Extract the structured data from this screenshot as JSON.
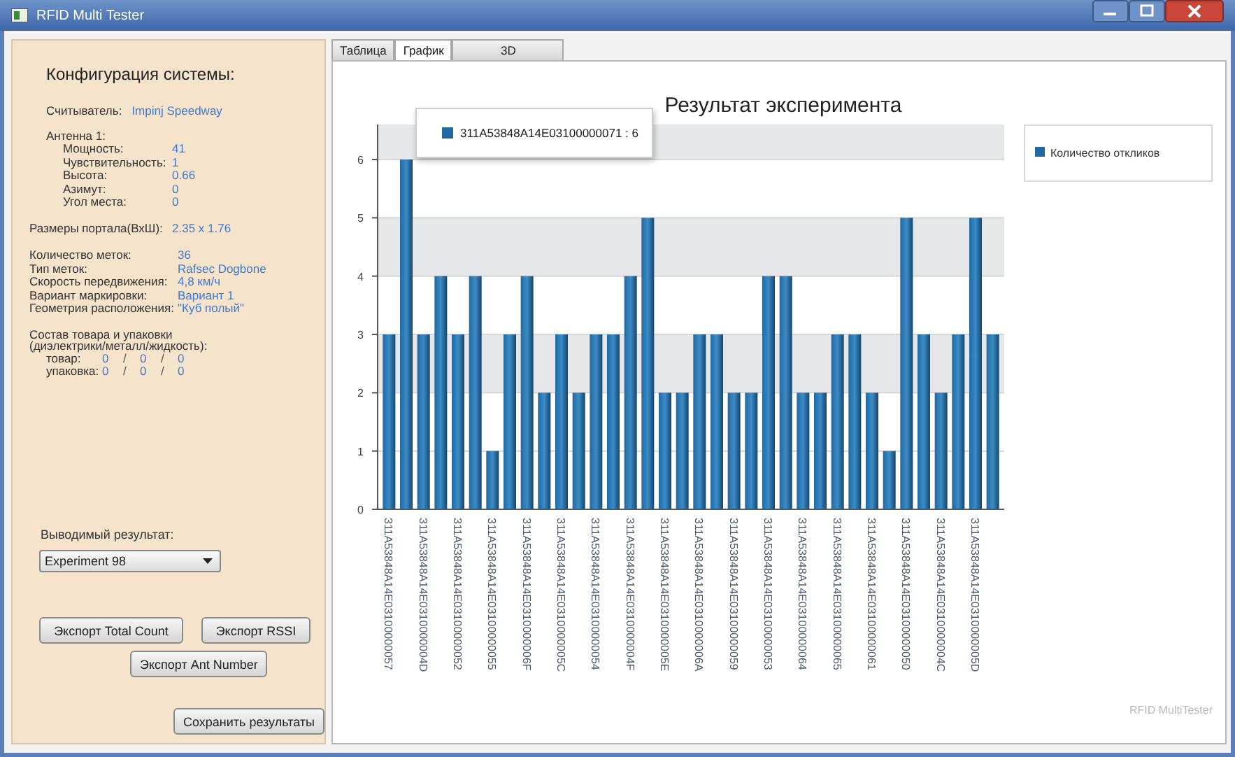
{
  "window": {
    "title": "RFID Multi Tester"
  },
  "config": {
    "title": "Конфигурация системы:",
    "reader": {
      "label": "Считыватель:",
      "value": "Impinj Speedway"
    },
    "antenna": {
      "title": "Антенна 1:",
      "rows": [
        {
          "label": "Мощность:",
          "value": "41"
        },
        {
          "label": "Чувствительность:",
          "value": "1"
        },
        {
          "label": "Высота:",
          "value": "0.66"
        },
        {
          "label": "Азимут:",
          "value": "0"
        },
        {
          "label": "Угол места:",
          "value": "0"
        }
      ]
    },
    "portal": {
      "label": "Размеры портала(ВхШ):",
      "value": "2.35 x 1.76"
    },
    "tags": [
      {
        "label": "Количество меток:",
        "value": "36"
      },
      {
        "label": "Тип меток:",
        "value": "Rafsec Dogbone"
      },
      {
        "label": "Скорость передвижения:",
        "value": "4,8 км/ч"
      },
      {
        "label": "Вариант маркировки:",
        "value": "Вариант 1"
      },
      {
        "label": "Геометрия расположения:",
        "value": "\"Куб полый\""
      }
    ],
    "composition": {
      "title": [
        "Состав товара и упаковки",
        "(диэлектрики/металл/жидкость):"
      ],
      "rows": [
        {
          "label": "товар:",
          "cells": [
            {
              "kind": "value",
              "text": "0"
            },
            {
              "kind": "sep",
              "text": "/"
            },
            {
              "kind": "value",
              "text": "0"
            },
            {
              "kind": "sep",
              "text": "/"
            },
            {
              "kind": "value",
              "text": "0"
            }
          ]
        },
        {
          "label": "упаковка:",
          "cells": [
            {
              "kind": "value",
              "text": "0"
            },
            {
              "kind": "sep",
              "text": "/"
            },
            {
              "kind": "value",
              "text": "0"
            },
            {
              "kind": "sep",
              "text": "/"
            },
            {
              "kind": "value",
              "text": "0"
            }
          ]
        }
      ]
    }
  },
  "result": {
    "label": "Выводимый результат:",
    "value": "Experiment 98"
  },
  "buttons": {
    "row1": [
      "Экспорт Total Count",
      "Экспорт RSSI"
    ],
    "row2": [
      "Экспорт Ant Number"
    ],
    "save": "Сохранить результаты"
  },
  "tabs": [
    {
      "label": "Таблица",
      "selected": false
    },
    {
      "label": "График",
      "selected": true
    },
    {
      "label": "3D",
      "selected": false
    }
  ],
  "chart": {
    "tooltip": "311A53848A14E03100000071 : 6",
    "watermark": "RFID MultiTester",
    "chart_data": {
      "type": "bar",
      "title": "Результат эксперимента",
      "categories": [
        "311A53848A14E03100000057",
        null,
        "311A53848A14E0310000004D",
        null,
        "311A53848A14E03100000052",
        null,
        "311A53848A14E03100000055",
        null,
        "311A53848A14E0310000006F",
        null,
        "311A53848A14E0310000005C",
        null,
        "311A53848A14E03100000054",
        null,
        "311A53848A14E0310000004F",
        null,
        "311A53848A14E0310000005E",
        null,
        "311A53848A14E0310000006A",
        null,
        "311A53848A14E03100000059",
        null,
        "311A53848A14E03100000053",
        null,
        "311A53848A14E03100000064",
        null,
        "311A53848A14E03100000065",
        null,
        "311A53848A14E03100000061",
        null,
        "311A53848A14E03100000050",
        null,
        "311A53848A14E0310000004C",
        null,
        "311A53848A14E0310000005D",
        null
      ],
      "series": [
        {
          "name": "Количество откликов",
          "color": "#1f6aa5",
          "values": [
            3,
            6,
            3,
            4,
            3,
            4,
            1,
            3,
            4,
            2,
            3,
            2,
            3,
            3,
            4,
            5,
            2,
            2,
            3,
            3,
            2,
            2,
            4,
            4,
            2,
            2,
            3,
            3,
            2,
            1,
            5,
            3,
            2,
            3,
            5,
            3
          ]
        }
      ],
      "ylim": [
        0,
        6.6
      ],
      "yticks": [
        0,
        1,
        2,
        3,
        4,
        5,
        6
      ],
      "grid": true
    }
  }
}
